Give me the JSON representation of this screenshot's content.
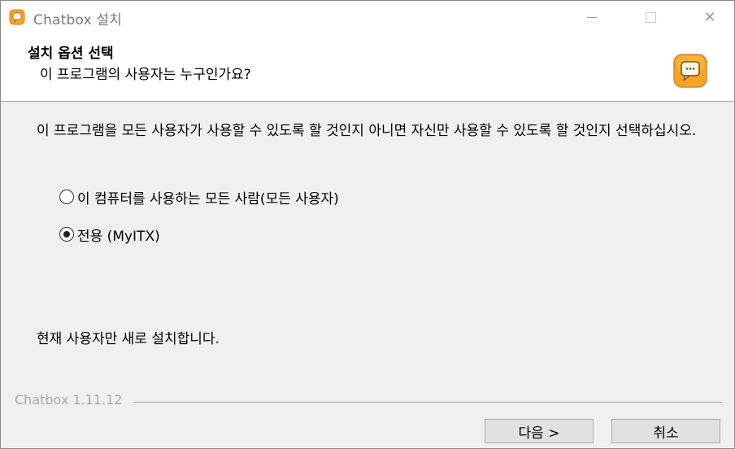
{
  "window": {
    "title": "Chatbox 설치",
    "icon": "chatbox-app-icon",
    "controls": {
      "minimize_icon": "minimize-icon",
      "maximize_icon": "maximize-icon",
      "close_icon": "close-icon",
      "close_glyph": "✕"
    }
  },
  "header": {
    "title": "설치 옵션 선택",
    "subtitle": "이 프로그램의 사용자는 누구인가요?"
  },
  "main": {
    "description": "이 프로그램을 모든 사용자가 사용할 수 있도록 할 것인지 아니면 자신만 사용할 수 있도록 할 것인지 선택하십시오.",
    "options": [
      {
        "label": "이 컴퓨터를 사용하는 모든 사람(모든 사용자)",
        "selected": false
      },
      {
        "label": "전용 (MyITX)",
        "selected": true
      }
    ],
    "status": "현재 사용자만 새로 설치합니다."
  },
  "footer": {
    "branding": "Chatbox 1.11.12",
    "next_label": "다음 >",
    "cancel_label": "취소"
  },
  "colors": {
    "icon_orange": "#f5a623",
    "icon_border": "#d9822b"
  }
}
